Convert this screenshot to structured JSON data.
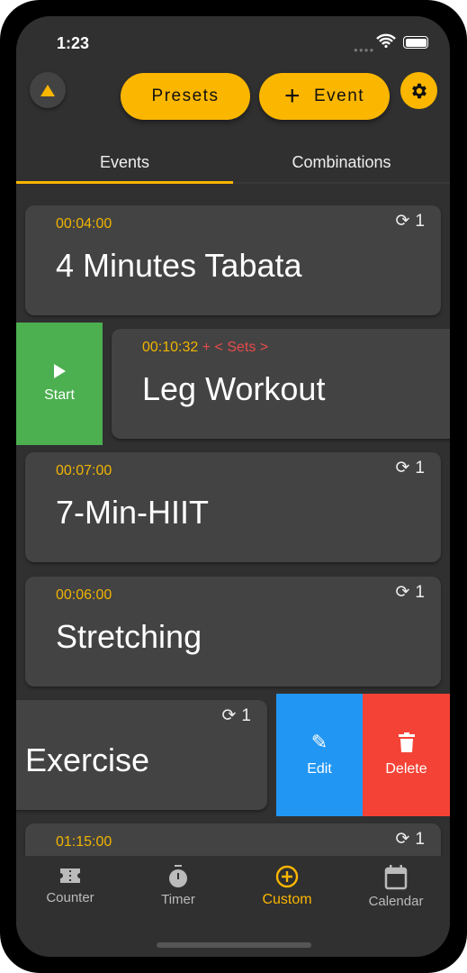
{
  "status": {
    "time": "1:23"
  },
  "header": {
    "presets_label": "Presets",
    "event_label": "Event"
  },
  "tabs": [
    {
      "label": "Events",
      "active": true
    },
    {
      "label": "Combinations",
      "active": false
    }
  ],
  "events": [
    {
      "time": "00:04:00",
      "title": "4 Minutes Tabata",
      "repeat": "1"
    },
    {
      "time": "00:10:32",
      "extra": "+ < Sets >",
      "title": "Leg Workout",
      "action": "Start"
    },
    {
      "time": "00:07:00",
      "title": "7-Min-HIIT",
      "repeat": "1"
    },
    {
      "time": "00:06:00",
      "title": "Stretching",
      "repeat": "1"
    },
    {
      "title": "Exercise",
      "repeat": "1",
      "edit": "Edit",
      "delete": "Delete"
    },
    {
      "time": "01:15:00",
      "repeat": "1"
    }
  ],
  "nav": [
    {
      "label": "Counter",
      "icon": "ticket-icon"
    },
    {
      "label": "Timer",
      "icon": "stopwatch-icon"
    },
    {
      "label": "Custom",
      "icon": "add-circle-icon",
      "active": true
    },
    {
      "label": "Calendar",
      "icon": "calendar-icon"
    }
  ],
  "colors": {
    "accent": "#fbb600",
    "start": "#4caf50",
    "edit": "#2196f3",
    "delete": "#f44336",
    "sets": "#e84b4b"
  }
}
